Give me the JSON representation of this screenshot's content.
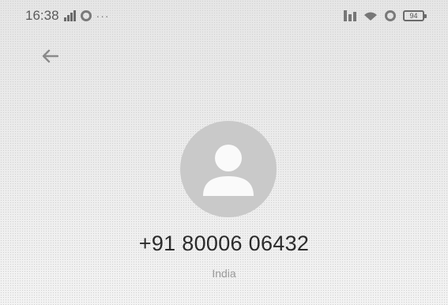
{
  "status_bar": {
    "time": "16:38",
    "overflow": "···",
    "battery": "94",
    "icons": [
      "signal-icon",
      "settings-icon",
      "notification-icon",
      "wifi-icon",
      "gear-icon",
      "battery-icon"
    ]
  },
  "header": {
    "back_icon": "arrow-left-icon"
  },
  "contact": {
    "avatar_icon": "person-icon",
    "phone": "+91 80006 06432",
    "country": "India"
  }
}
